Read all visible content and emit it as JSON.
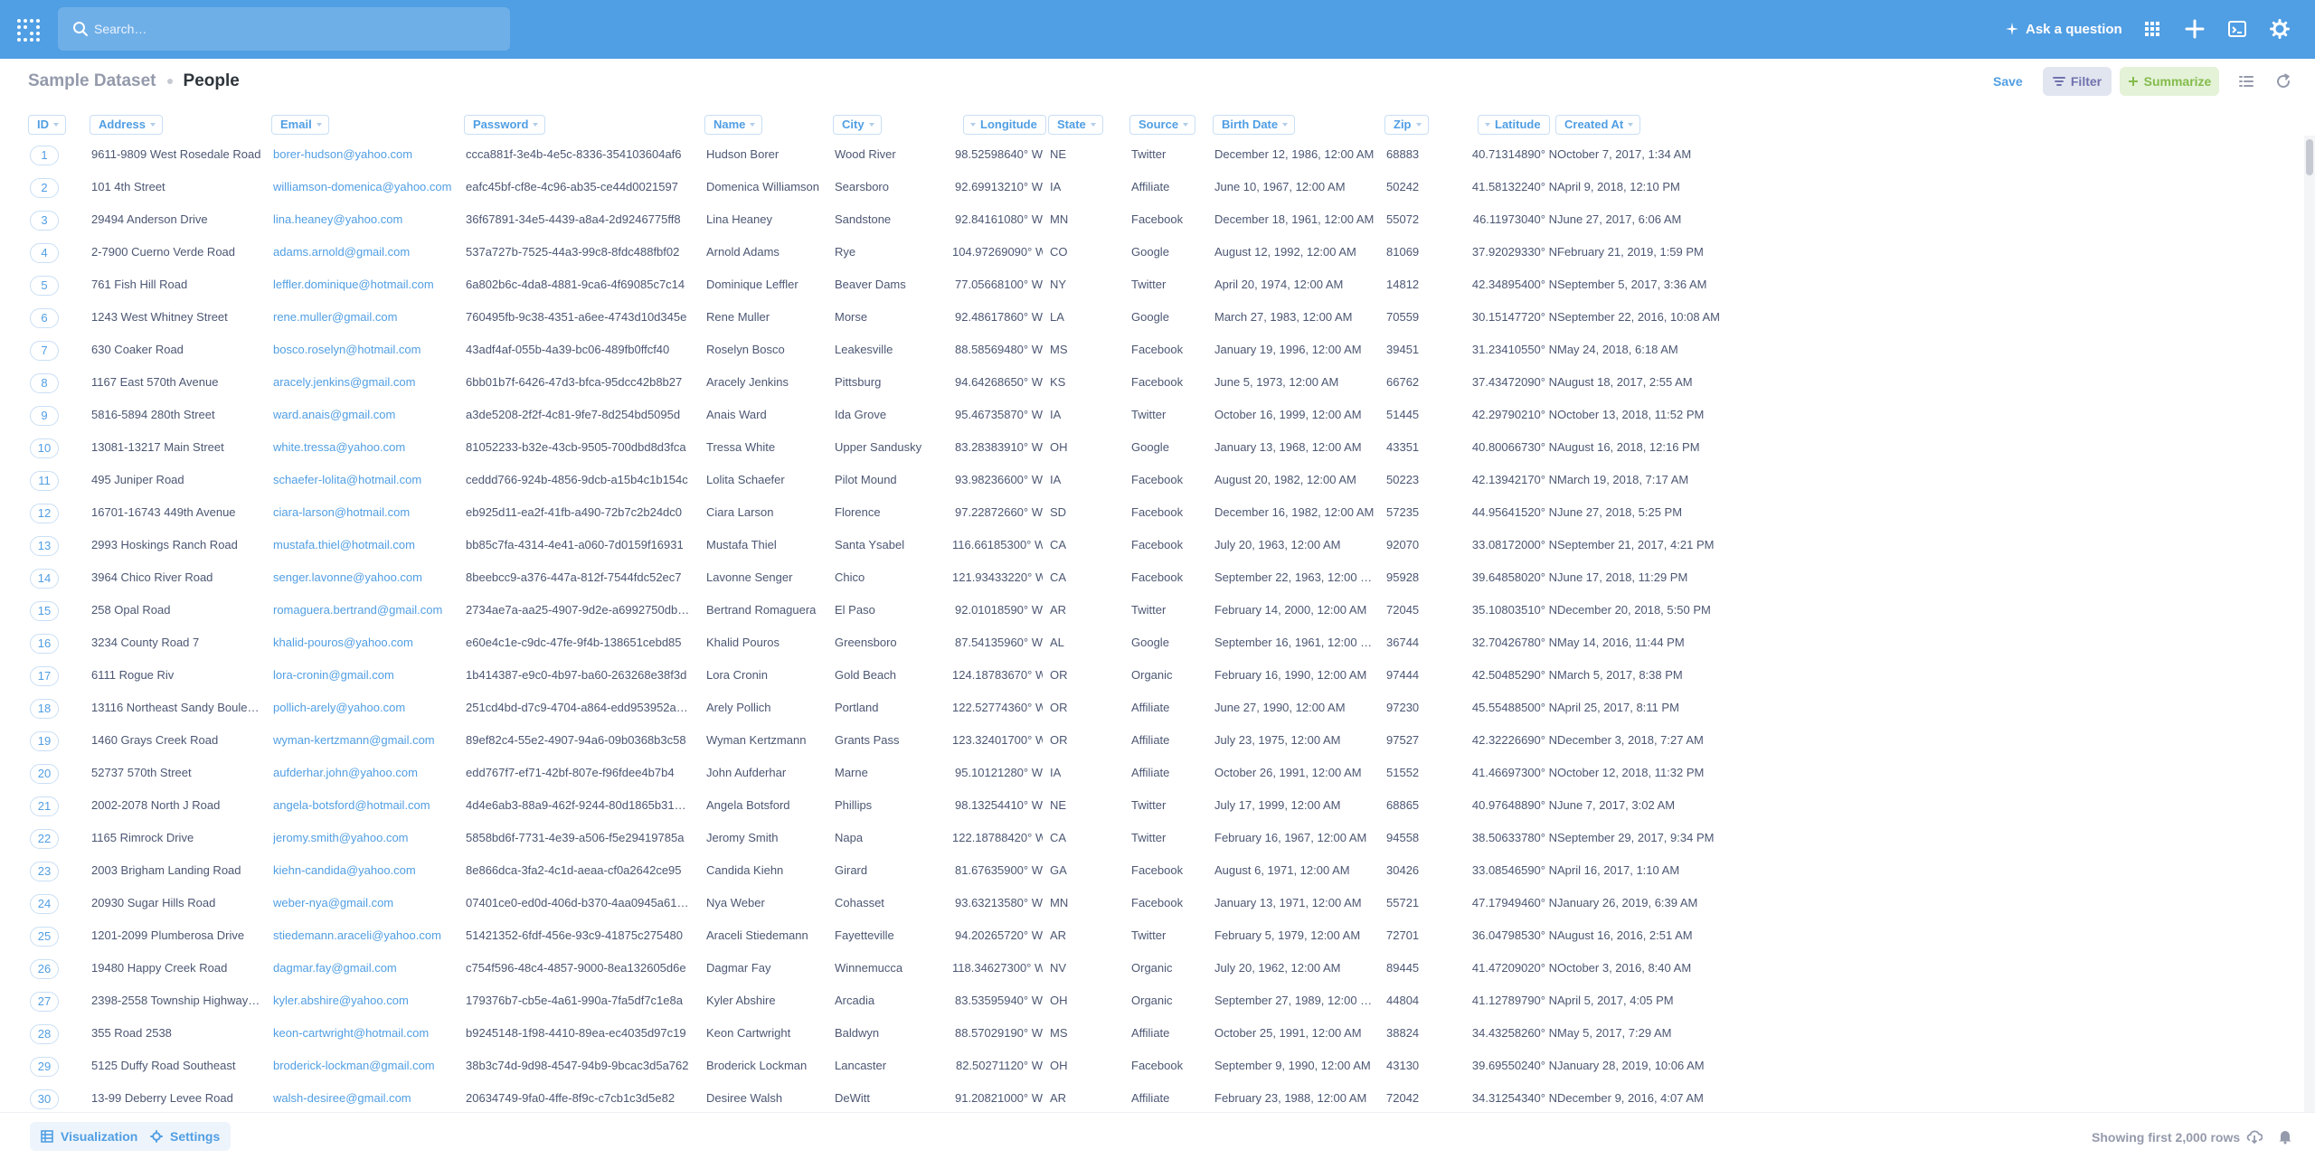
{
  "nav": {
    "search_placeholder": "Search…",
    "ask_label": "Ask a question"
  },
  "header": {
    "database": "Sample Dataset",
    "table": "People",
    "save": "Save",
    "filter": "Filter",
    "summarize": "Summarize"
  },
  "columns": [
    "ID",
    "Address",
    "Email",
    "Password",
    "Name",
    "City",
    "Longitude",
    "State",
    "Source",
    "Birth Date",
    "Zip",
    "Latitude",
    "Created At"
  ],
  "rows": [
    [
      "1",
      "9611-9809 West Rosedale Road",
      "borer-hudson@yahoo.com",
      "ccca881f-3e4b-4e5c-8336-354103604af6",
      "Hudson Borer",
      "Wood River",
      "98.52598640° W",
      "NE",
      "Twitter",
      "December 12, 1986, 12:00 AM",
      "68883",
      "40.71314890° N",
      "October 7, 2017, 1:34 AM"
    ],
    [
      "2",
      "101 4th Street",
      "williamson-domenica@yahoo.com",
      "eafc45bf-cf8e-4c96-ab35-ce44d0021597",
      "Domenica Williamson",
      "Searsboro",
      "92.69913210° W",
      "IA",
      "Affiliate",
      "June 10, 1967, 12:00 AM",
      "50242",
      "41.58132240° N",
      "April 9, 2018, 12:10 PM"
    ],
    [
      "3",
      "29494 Anderson Drive",
      "lina.heaney@yahoo.com",
      "36f67891-34e5-4439-a8a4-2d9246775ff8",
      "Lina Heaney",
      "Sandstone",
      "92.84161080° W",
      "MN",
      "Facebook",
      "December 18, 1961, 12:00 AM",
      "55072",
      "46.11973040° N",
      "June 27, 2017, 6:06 AM"
    ],
    [
      "4",
      "2-7900 Cuerno Verde Road",
      "adams.arnold@gmail.com",
      "537a727b-7525-44a3-99c8-8fdc488fbf02",
      "Arnold Adams",
      "Rye",
      "104.97269090° W",
      "CO",
      "Google",
      "August 12, 1992, 12:00 AM",
      "81069",
      "37.92029330° N",
      "February 21, 2019, 1:59 PM"
    ],
    [
      "5",
      "761 Fish Hill Road",
      "leffler.dominique@hotmail.com",
      "6a802b6c-4da8-4881-9ca6-4f69085c7c14",
      "Dominique Leffler",
      "Beaver Dams",
      "77.05668100° W",
      "NY",
      "Twitter",
      "April 20, 1974, 12:00 AM",
      "14812",
      "42.34895400° N",
      "September 5, 2017, 3:36 AM"
    ],
    [
      "6",
      "1243 West Whitney Street",
      "rene.muller@gmail.com",
      "760495fb-9c38-4351-a6ee-4743d10d345e",
      "Rene Muller",
      "Morse",
      "92.48617860° W",
      "LA",
      "Google",
      "March 27, 1983, 12:00 AM",
      "70559",
      "30.15147720° N",
      "September 22, 2016, 10:08 AM"
    ],
    [
      "7",
      "630 Coaker Road",
      "bosco.roselyn@hotmail.com",
      "43adf4af-055b-4a39-bc06-489fb0ffcf40",
      "Roselyn Bosco",
      "Leakesville",
      "88.58569480° W",
      "MS",
      "Facebook",
      "January 19, 1996, 12:00 AM",
      "39451",
      "31.23410550° N",
      "May 24, 2018, 6:18 AM"
    ],
    [
      "8",
      "1167 East 570th Avenue",
      "aracely.jenkins@gmail.com",
      "6bb01b7f-6426-47d3-bfca-95dcc42b8b27",
      "Aracely Jenkins",
      "Pittsburg",
      "94.64268650° W",
      "KS",
      "Facebook",
      "June 5, 1973, 12:00 AM",
      "66762",
      "37.43472090° N",
      "August 18, 2017, 2:55 AM"
    ],
    [
      "9",
      "5816-5894 280th Street",
      "ward.anais@gmail.com",
      "a3de5208-2f2f-4c81-9fe7-8d254bd5095d",
      "Anais Ward",
      "Ida Grove",
      "95.46735870° W",
      "IA",
      "Twitter",
      "October 16, 1999, 12:00 AM",
      "51445",
      "42.29790210° N",
      "October 13, 2018, 11:52 PM"
    ],
    [
      "10",
      "13081-13217 Main Street",
      "white.tressa@yahoo.com",
      "81052233-b32e-43cb-9505-700dbd8d3fca",
      "Tressa White",
      "Upper Sandusky",
      "83.28383910° W",
      "OH",
      "Google",
      "January 13, 1968, 12:00 AM",
      "43351",
      "40.80066730° N",
      "August 16, 2018, 12:16 PM"
    ],
    [
      "11",
      "495 Juniper Road",
      "schaefer-lolita@hotmail.com",
      "ceddd766-924b-4856-9dcb-a15b4c1b154c",
      "Lolita Schaefer",
      "Pilot Mound",
      "93.98236600° W",
      "IA",
      "Facebook",
      "August 20, 1982, 12:00 AM",
      "50223",
      "42.13942170° N",
      "March 19, 2018, 7:17 AM"
    ],
    [
      "12",
      "16701-16743 449th Avenue",
      "ciara-larson@hotmail.com",
      "eb925d11-ea2f-41fb-a490-72b7c2b24dc0",
      "Ciara Larson",
      "Florence",
      "97.22872660° W",
      "SD",
      "Facebook",
      "December 16, 1982, 12:00 AM",
      "57235",
      "44.95641520° N",
      "June 27, 2018, 5:25 PM"
    ],
    [
      "13",
      "2993 Hoskings Ranch Road",
      "mustafa.thiel@hotmail.com",
      "bb85c7fa-4314-4e41-a060-7d0159f16931",
      "Mustafa Thiel",
      "Santa Ysabel",
      "116.66185300° W",
      "CA",
      "Facebook",
      "July 20, 1963, 12:00 AM",
      "92070",
      "33.08172000° N",
      "September 21, 2017, 4:21 PM"
    ],
    [
      "14",
      "3964 Chico River Road",
      "senger.lavonne@yahoo.com",
      "8beebcc9-a376-447a-812f-7544fdc52ec7",
      "Lavonne Senger",
      "Chico",
      "121.93433220° W",
      "CA",
      "Facebook",
      "September 22, 1963, 12:00 …",
      "95928",
      "39.64858020° N",
      "June 17, 2018, 11:29 PM"
    ],
    [
      "15",
      "258 Opal Road",
      "romaguera.bertrand@gmail.com",
      "2734ae7a-aa25-4907-9d2e-a6992750db…",
      "Bertrand Romaguera",
      "El Paso",
      "92.01018590° W",
      "AR",
      "Twitter",
      "February 14, 2000, 12:00 AM",
      "72045",
      "35.10803510° N",
      "December 20, 2018, 5:50 PM"
    ],
    [
      "16",
      "3234 County Road 7",
      "khalid-pouros@yahoo.com",
      "e60e4c1e-c9dc-47fe-9f4b-138651cebd85",
      "Khalid Pouros",
      "Greensboro",
      "87.54135960° W",
      "AL",
      "Google",
      "September 16, 1961, 12:00 …",
      "36744",
      "32.70426780° N",
      "May 14, 2016, 11:44 PM"
    ],
    [
      "17",
      "6111 Rogue Riv",
      "lora-cronin@gmail.com",
      "1b414387-e9c0-4b97-ba60-263268e38f3d",
      "Lora Cronin",
      "Gold Beach",
      "124.18783670° W",
      "OR",
      "Organic",
      "February 16, 1990, 12:00 AM",
      "97444",
      "42.50485290° N",
      "March 5, 2017, 8:38 PM"
    ],
    [
      "18",
      "13116 Northeast Sandy Boule…",
      "pollich-arely@yahoo.com",
      "251cd4bd-d7c9-4704-a864-edd953952a…",
      "Arely Pollich",
      "Portland",
      "122.52774360° W",
      "OR",
      "Affiliate",
      "June 27, 1990, 12:00 AM",
      "97230",
      "45.55488500° N",
      "April 25, 2017, 8:11 PM"
    ],
    [
      "19",
      "1460 Grays Creek Road",
      "wyman-kertzmann@gmail.com",
      "89ef82c4-55e2-4907-94a6-09b0368b3c58",
      "Wyman Kertzmann",
      "Grants Pass",
      "123.32401700° W",
      "OR",
      "Affiliate",
      "July 23, 1975, 12:00 AM",
      "97527",
      "42.32226690° N",
      "December 3, 2018, 7:27 AM"
    ],
    [
      "20",
      "52737 570th Street",
      "aufderhar.john@yahoo.com",
      "edd767f7-ef71-42bf-807e-f96fdee4b7b4",
      "John Aufderhar",
      "Marne",
      "95.10121280° W",
      "IA",
      "Affiliate",
      "October 26, 1991, 12:00 AM",
      "51552",
      "41.46697300° N",
      "October 12, 2018, 11:32 PM"
    ],
    [
      "21",
      "2002-2078 North J Road",
      "angela-botsford@hotmail.com",
      "4d4e6ab3-88a9-462f-9244-80d1865b31…",
      "Angela Botsford",
      "Phillips",
      "98.13254410° W",
      "NE",
      "Twitter",
      "July 17, 1999, 12:00 AM",
      "68865",
      "40.97648890° N",
      "June 7, 2017, 3:02 AM"
    ],
    [
      "22",
      "1165 Rimrock Drive",
      "jeromy.smith@yahoo.com",
      "5858bd6f-7731-4e39-a506-f5e29419785a",
      "Jeromy Smith",
      "Napa",
      "122.18788420° W",
      "CA",
      "Twitter",
      "February 16, 1967, 12:00 AM",
      "94558",
      "38.50633780° N",
      "September 29, 2017, 9:34 PM"
    ],
    [
      "23",
      "2003 Brigham Landing Road",
      "kiehn-candida@yahoo.com",
      "8e866dca-3fa2-4c1d-aeaa-cf0a2642ce95",
      "Candida Kiehn",
      "Girard",
      "81.67635900° W",
      "GA",
      "Facebook",
      "August 6, 1971, 12:00 AM",
      "30426",
      "33.08546590° N",
      "April 16, 2017, 1:10 AM"
    ],
    [
      "24",
      "20930 Sugar Hills Road",
      "weber-nya@gmail.com",
      "07401ce0-ed0d-406d-b370-4aa0945a61…",
      "Nya Weber",
      "Cohasset",
      "93.63213580° W",
      "MN",
      "Facebook",
      "January 13, 1971, 12:00 AM",
      "55721",
      "47.17949460° N",
      "January 26, 2019, 6:39 AM"
    ],
    [
      "25",
      "1201-2099 Plumberosa Drive",
      "stiedemann.araceli@yahoo.com",
      "51421352-6fdf-456e-93c9-41875c275480",
      "Araceli Stiedemann",
      "Fayetteville",
      "94.20265720° W",
      "AR",
      "Twitter",
      "February 5, 1979, 12:00 AM",
      "72701",
      "36.04798530° N",
      "August 16, 2016, 2:51 AM"
    ],
    [
      "26",
      "19480 Happy Creek Road",
      "dagmar.fay@gmail.com",
      "c754f596-48c4-4857-9000-8ea132605d6e",
      "Dagmar Fay",
      "Winnemucca",
      "118.34627300° W",
      "NV",
      "Organic",
      "July 20, 1962, 12:00 AM",
      "89445",
      "41.47209020° N",
      "October 3, 2016, 8:40 AM"
    ],
    [
      "27",
      "2398-2558 Township Highway…",
      "kyler.abshire@yahoo.com",
      "179376b7-cb5e-4a61-990a-7fa5df7c1e8a",
      "Kyler Abshire",
      "Arcadia",
      "83.53595940° W",
      "OH",
      "Organic",
      "September 27, 1989, 12:00 …",
      "44804",
      "41.12789790° N",
      "April 5, 2017, 4:05 PM"
    ],
    [
      "28",
      "355 Road 2538",
      "keon-cartwright@hotmail.com",
      "b9245148-1f98-4410-89ea-ec4035d97c19",
      "Keon Cartwright",
      "Baldwyn",
      "88.57029190° W",
      "MS",
      "Affiliate",
      "October 25, 1991, 12:00 AM",
      "38824",
      "34.43258260° N",
      "May 5, 2017, 7:29 AM"
    ],
    [
      "29",
      "5125 Duffy Road Southeast",
      "broderick-lockman@gmail.com",
      "38b3c74d-9d98-4547-94b9-9bcac3d5a762",
      "Broderick Lockman",
      "Lancaster",
      "82.50271120° W",
      "OH",
      "Facebook",
      "September 9, 1990, 12:00 AM",
      "43130",
      "39.69550240° N",
      "January 28, 2019, 10:06 AM"
    ],
    [
      "30",
      "13-99 Deberry Levee Road",
      "walsh-desiree@gmail.com",
      "20634749-9fa0-4ffe-8f9c-c7cb1c3d5e82",
      "Desiree Walsh",
      "DeWitt",
      "91.20821000° W",
      "AR",
      "Affiliate",
      "February 23, 1988, 12:00 AM",
      "72042",
      "34.31254340° N",
      "December 9, 2016, 4:07 AM"
    ]
  ],
  "footer": {
    "visualization": "Visualization",
    "settings": "Settings",
    "showing": "Showing first 2,000 rows"
  },
  "colors": {
    "brand": "#509ee3",
    "filter": "#7172ad",
    "summarize": "#84bb4c"
  },
  "icons": [
    "metabase-logo-icon",
    "search-icon",
    "sparkle-icon",
    "grid-icon",
    "plus-icon",
    "terminal-icon",
    "gear-icon",
    "filter-icon",
    "plus-small-icon",
    "list-icon",
    "refresh-icon",
    "table-icon",
    "gear-small-icon",
    "download-icon",
    "bell-icon"
  ]
}
